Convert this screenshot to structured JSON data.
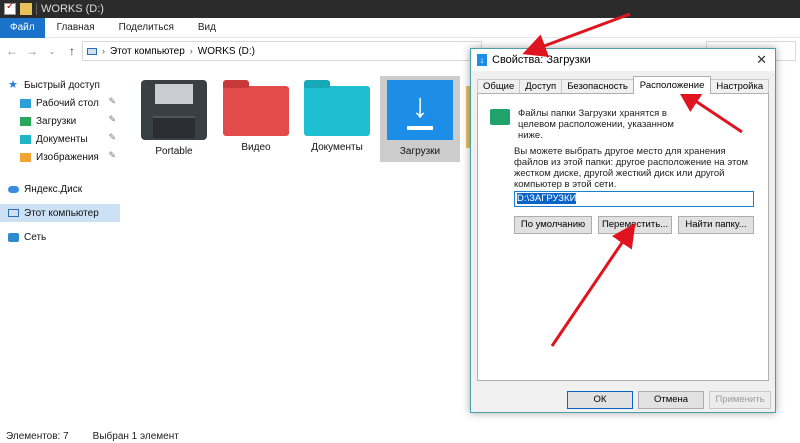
{
  "explorer": {
    "window_title": "WORKS (D:)",
    "ribbon_tabs": [
      "Файл",
      "Главная",
      "Поделиться",
      "Вид"
    ],
    "address": {
      "segments": [
        "Этот компьютер",
        "WORKS (D:)"
      ]
    },
    "nav_pane": {
      "quick_access": "Быстрый доступ",
      "quick_items": [
        "Рабочий стол",
        "Загрузки",
        "Документы",
        "Изображения"
      ],
      "yandex_disk": "Яндекс.Диск",
      "this_pc": "Этот компьютер",
      "network": "Сеть"
    },
    "folders": [
      "Portable",
      "Видео",
      "Документы",
      "Загрузки"
    ],
    "status": {
      "items": "Элементов: 7",
      "selected": "Выбран 1 элемент"
    }
  },
  "dialog": {
    "title": "Свойства: Загрузки",
    "close_glyph": "✕",
    "tabs": [
      "Общие",
      "Доступ",
      "Безопасность",
      "Расположение",
      "Настройка"
    ],
    "active_tab": "Расположение",
    "info_text": "Файлы папки Загрузки хранятся в целевом расположении, указанном ниже.",
    "hint_text": "Вы можете выбрать другое место для хранения файлов из этой папки: другое расположение на этом жестком диске, другой жесткий диск или другой компьютер в этой сети.",
    "path_value": "D:\\ЗАГРУЗКИ",
    "buttons": {
      "default": "По умолчанию",
      "move": "Переместить...",
      "find": "Найти папку...",
      "ok": "ОК",
      "cancel": "Отмена",
      "apply": "Применить"
    }
  },
  "colors": {
    "accent": "#1a73c8",
    "annotation_arrow": "#e0141e",
    "folder_blue": "#1c8ee8"
  }
}
